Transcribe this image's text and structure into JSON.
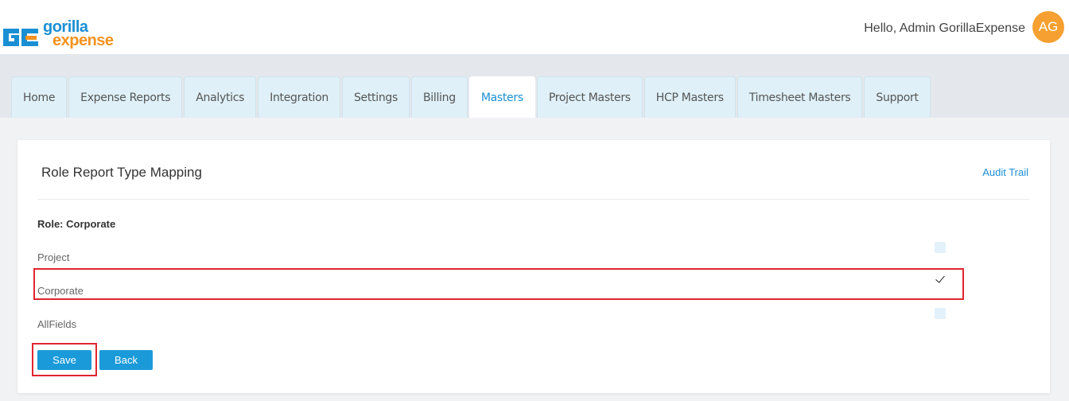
{
  "brand": {
    "name_top": "gorilla",
    "name_bottom": "expense",
    "primary": "#1a8fd4",
    "accent": "#f6921e"
  },
  "header": {
    "greeting": "Hello, Admin GorillaExpense",
    "avatar_initials": "AG"
  },
  "nav": {
    "tabs": [
      {
        "label": "Home",
        "active": false
      },
      {
        "label": "Expense Reports",
        "active": false
      },
      {
        "label": "Analytics",
        "active": false
      },
      {
        "label": "Integration",
        "active": false
      },
      {
        "label": "Settings",
        "active": false
      },
      {
        "label": "Billing",
        "active": false
      },
      {
        "label": "Masters",
        "active": true
      },
      {
        "label": "Project Masters",
        "active": false
      },
      {
        "label": "HCP Masters",
        "active": false
      },
      {
        "label": "Timesheet Masters",
        "active": false
      },
      {
        "label": "Support",
        "active": false
      }
    ]
  },
  "page": {
    "title": "Role Report Type Mapping",
    "audit_link": "Audit Trail",
    "role_label": "Role: Corporate",
    "report_types": [
      {
        "label": "Project",
        "checked": false
      },
      {
        "label": "Corporate",
        "checked": true
      },
      {
        "label": "AllFields",
        "checked": false
      }
    ],
    "buttons": {
      "save": "Save",
      "back": "Back"
    }
  }
}
